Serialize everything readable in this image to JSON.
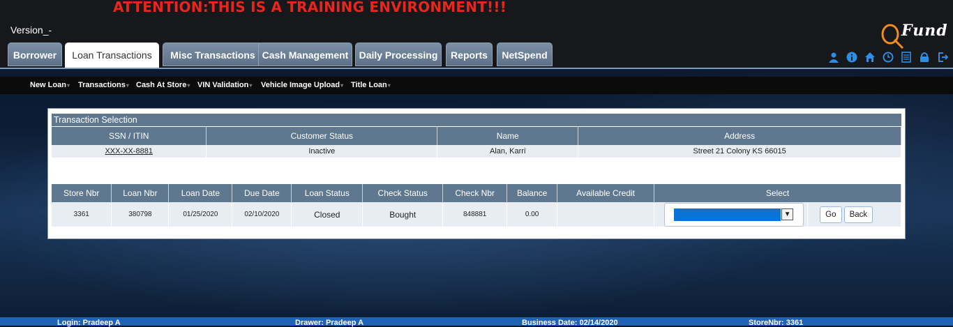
{
  "banner": {
    "attention": "ATTENTION:THIS IS A TRAINING ENVIRONMENT!!!",
    "version": "Version_-"
  },
  "brand": {
    "logo_text": "Fund"
  },
  "tabs": [
    {
      "label": "Borrower"
    },
    {
      "label": "Loan Transactions",
      "active": true
    },
    {
      "label": "Misc Transactions"
    },
    {
      "label": "Cash Management"
    },
    {
      "label": "Daily Processing"
    },
    {
      "label": "Reports"
    },
    {
      "label": "NetSpend"
    }
  ],
  "toolbar_icons": [
    "user-icon",
    "info-icon",
    "home-icon",
    "clock-icon",
    "calculator-icon",
    "lock-icon",
    "logout-icon"
  ],
  "subnav": [
    {
      "label": "New Loan"
    },
    {
      "label": "Transactions"
    },
    {
      "label": "Cash At Store"
    },
    {
      "label": "VIN Validation"
    },
    {
      "label": "Vehicle Image Upload"
    },
    {
      "label": "Title Loan"
    }
  ],
  "panel": {
    "title": "Transaction Selection",
    "customer_headers": [
      "SSN / ITIN",
      "Customer Status",
      "Name",
      "Address"
    ],
    "customer": {
      "ssn": "XXX-XX-8881",
      "status": "Inactive",
      "name": "Alan, Karri",
      "address": "Street 21 Colony KS 66015"
    },
    "loan_headers": [
      "Store Nbr",
      "Loan Nbr",
      "Loan Date",
      "Due Date",
      "Loan Status",
      "Check Status",
      "Check Nbr",
      "Balance",
      "Available Credit",
      "Select"
    ],
    "loan": {
      "store_nbr": "3361",
      "loan_nbr": "380798",
      "loan_date": "01/25/2020",
      "due_date": "02/10/2020",
      "loan_status": "Closed",
      "check_status": "Bought",
      "check_nbr": "848881",
      "balance": "0.00",
      "available_credit": ""
    },
    "go_label": "Go",
    "back_label": "Back"
  },
  "footer": {
    "login": "Login: Pradeep A",
    "drawer": "Drawer: Pradeep A",
    "business_date": "Business Date: 02/14/2020",
    "store": "StoreNbr: 3361"
  },
  "colors": {
    "accent": "#0a74d6",
    "header_bg": "#60788f",
    "warning": "#e8261c",
    "footer": "#1f62b6"
  }
}
